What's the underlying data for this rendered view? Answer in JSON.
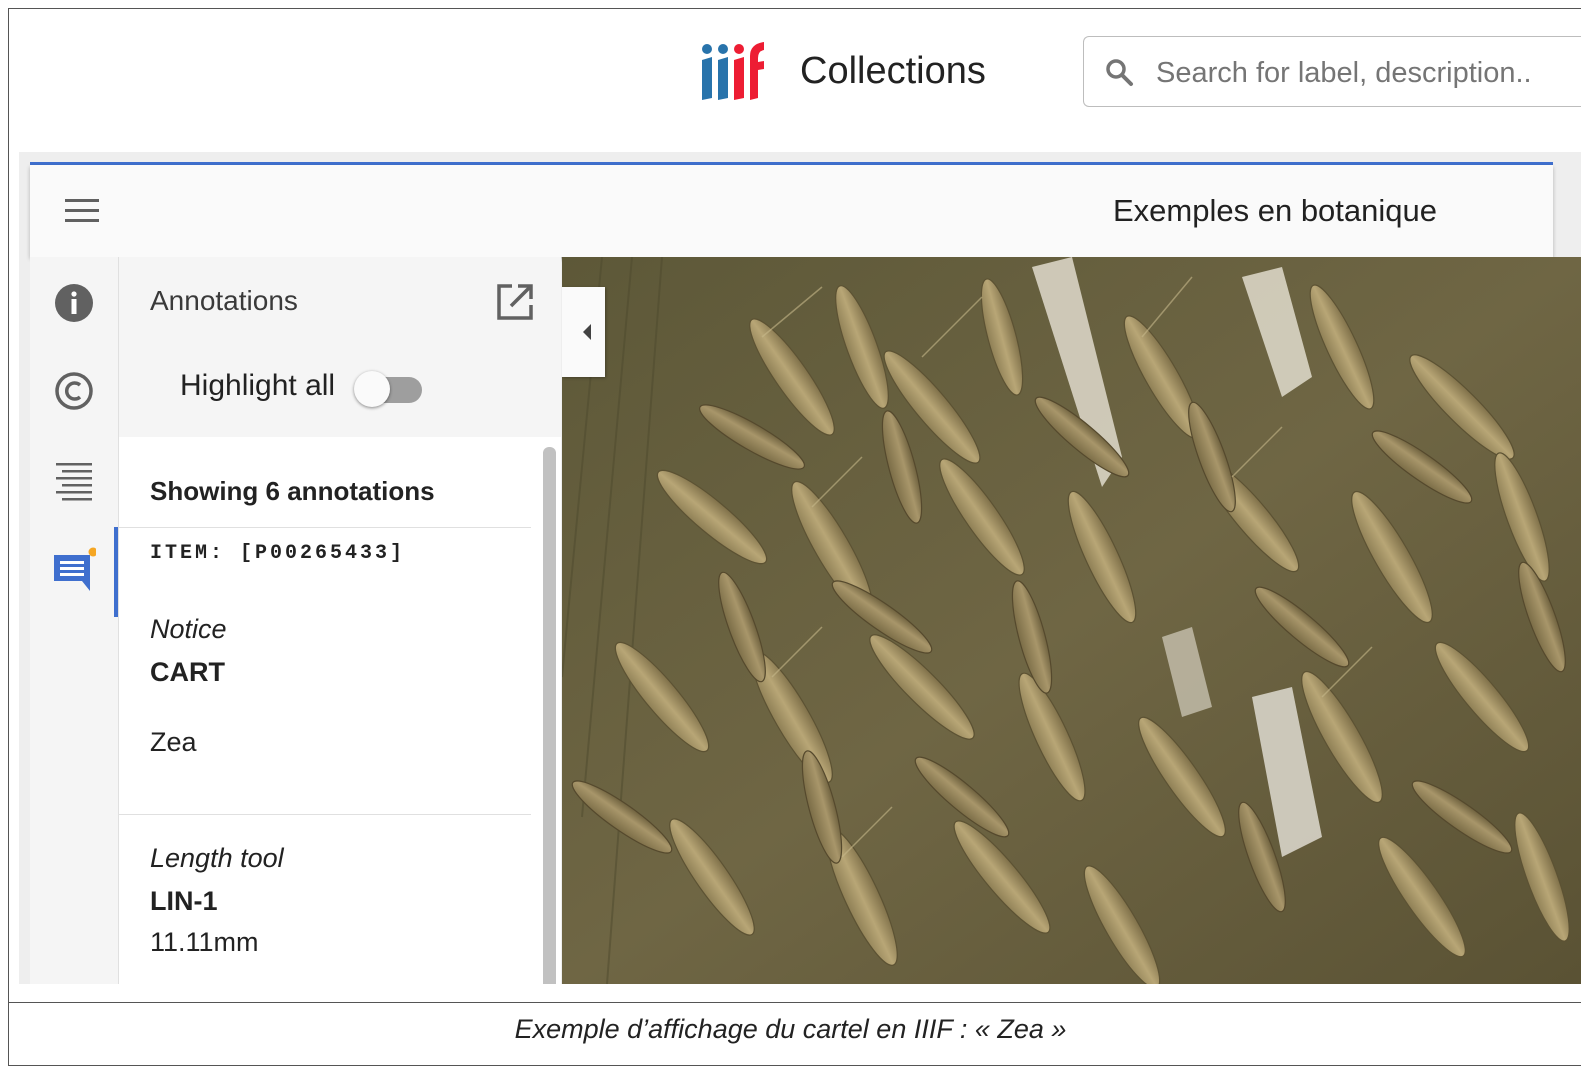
{
  "header": {
    "site_title": "Collections",
    "search": {
      "placeholder": "Search for label, description..",
      "icon": "search-icon"
    },
    "logo": {
      "label": "iiif",
      "colors": [
        "#2873AB",
        "#ED1D33"
      ]
    }
  },
  "viewer": {
    "window_title": "Exemples en botanique",
    "accent_color": "#3F6FCE",
    "rail_items": [
      {
        "icon": "info-icon",
        "active": false
      },
      {
        "icon": "copyright-icon",
        "active": false
      },
      {
        "icon": "table-of-contents-icon",
        "active": false
      },
      {
        "icon": "annotations-icon",
        "active": true,
        "has_notification_dot": true
      }
    ],
    "panel": {
      "title": "Annotations",
      "highlight_all": {
        "label": "Highlight all",
        "on": false
      },
      "count_label": "Showing 6 annotations",
      "annotations": [
        {
          "item_id": "ITEM: [P00265433]",
          "type": "Notice",
          "code": "CART",
          "value": "Zea"
        },
        {
          "type": "Length tool",
          "code": "LIN-1",
          "value": "11.11mm"
        }
      ]
    }
  },
  "caption": "Exemple d’affichage du cartel en IIIF : « Zea »"
}
